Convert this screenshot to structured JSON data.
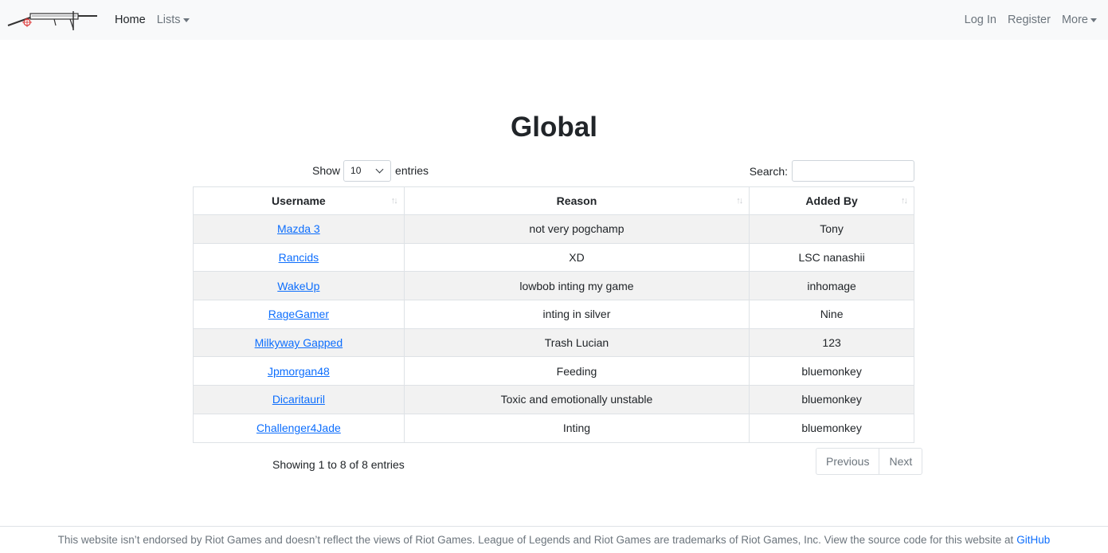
{
  "navbar": {
    "logo_icon": "rifle-logo-icon",
    "links": [
      {
        "label": "Home",
        "active": true
      },
      {
        "label": "Lists",
        "dropdown": true
      }
    ],
    "right_links": [
      {
        "label": "Log In"
      },
      {
        "label": "Register"
      },
      {
        "label": "More",
        "dropdown": true
      }
    ]
  },
  "page": {
    "title": "Global"
  },
  "table_controls": {
    "show_label": "Show",
    "page_length": "10",
    "entries_label": "entries",
    "search_label": "Search:",
    "search_value": ""
  },
  "table": {
    "columns": [
      "Username",
      "Reason",
      "Added By"
    ],
    "rows": [
      {
        "username": "Mazda 3",
        "reason": "not very pogchamp",
        "added_by": "Tony"
      },
      {
        "username": "Rancids",
        "reason": "XD",
        "added_by": "LSC nanashii"
      },
      {
        "username": "WakeUp",
        "reason": "lowbob inting my game",
        "added_by": "inhomage"
      },
      {
        "username": "RageGamer",
        "reason": "inting in silver",
        "added_by": "Nine"
      },
      {
        "username": "Milkyway Gapped",
        "reason": "Trash Lucian",
        "added_by": "123"
      },
      {
        "username": "Jpmorgan48",
        "reason": "Feeding",
        "added_by": "bluemonkey"
      },
      {
        "username": "Dicaritauril",
        "reason": "Toxic and emotionally unstable",
        "added_by": "bluemonkey"
      },
      {
        "username": "Challenger4Jade",
        "reason": "Inting",
        "added_by": "bluemonkey"
      }
    ]
  },
  "pagination": {
    "info": "Showing 1 to 8 of 8 entries",
    "previous": "Previous",
    "next": "Next"
  },
  "footer": {
    "text": "This website isn’t endorsed by Riot Games and doesn’t reflect the views of Riot Games. League of Legends and Riot Games are trademarks of Riot Games, Inc. View the source code for this website at",
    "link": "GitHub"
  },
  "colors": {
    "link": "#0d6efd",
    "navbar_bg": "#f8f9fa",
    "stripe": "#f2f2f2"
  }
}
